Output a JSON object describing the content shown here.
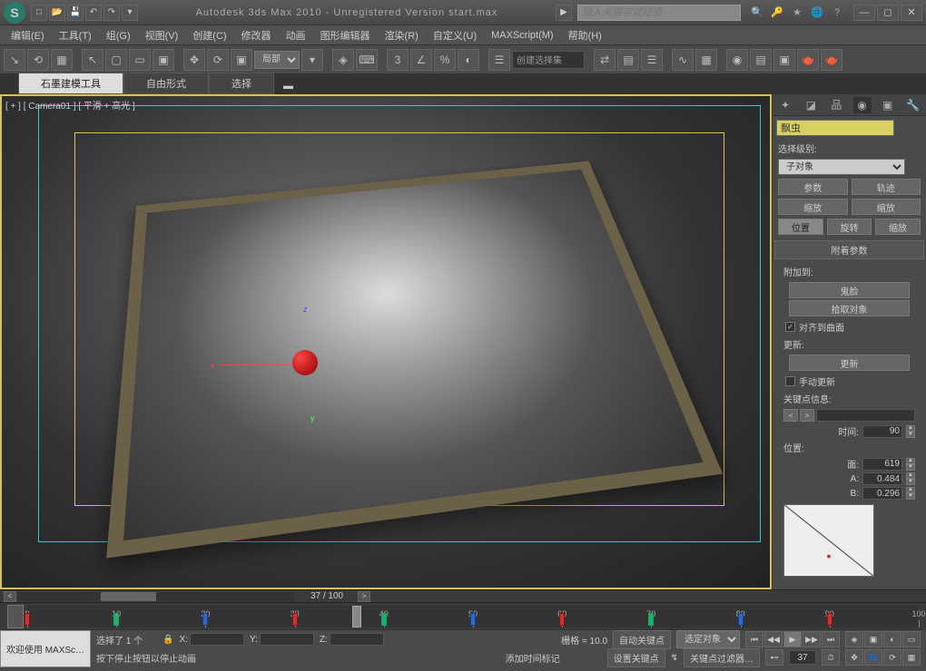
{
  "title": "Autodesk 3ds Max 2010  - Unregistered Version  start.max",
  "search_placeholder": "键入关键字或短语",
  "menus": [
    "编辑(E)",
    "工具(T)",
    "组(G)",
    "视图(V)",
    "创建(C)",
    "修改器",
    "动画",
    "图形编辑器",
    "渲染(R)",
    "自定义(U)",
    "MAXScript(M)",
    "帮助(H)"
  ],
  "coord_system": "局部",
  "named_sets": "创建选择集",
  "tabs": {
    "active": "石墨建模工具",
    "items": [
      "石墨建模工具",
      "自由形式",
      "选择"
    ]
  },
  "viewport_label": "[ + ] [ Camera01 ] [ 平滑 + 高光 ]",
  "frame_display": "37 / 100",
  "timeline": {
    "start": 0,
    "end": 100,
    "current": 37,
    "ticks": [
      0,
      10,
      20,
      30,
      40,
      50,
      60,
      70,
      80,
      90,
      100
    ],
    "keys": [
      0,
      10,
      20,
      30,
      40,
      50,
      60,
      70,
      80,
      90
    ]
  },
  "right_panel": {
    "obj_name": "飘虫",
    "selection_level_label": "选择级别:",
    "selection_level": "子对象",
    "tab_params": "参数",
    "tab_track": "轨迹",
    "scale1": "缩放",
    "scale2": "缩放",
    "pos": "位置",
    "rot": "旋转",
    "scale": "缩放",
    "rollout_attach": "附着参数",
    "attach_to": "附加到:",
    "ghost_face": "鬼脸",
    "pick_obj": "拾取对象",
    "align_surface": "对齐到曲面",
    "update_label": "更新:",
    "update_btn": "更新",
    "manual_update": "手动更新",
    "key_info": "关键点信息:",
    "time_label": "时间:",
    "time_val": "90",
    "pos_label": "位置:",
    "face_label": "面:",
    "face_val": "619",
    "a_label": "A:",
    "a_val": "0.484",
    "b_label": "B:",
    "b_val": "0.296"
  },
  "status": {
    "welcome": "欢迎使用 MAXSc…",
    "selected": "选择了 1 个",
    "x": "X:",
    "y": "Y:",
    "z": "Z:",
    "grid": "栅格 = 10.0",
    "auto_key": "自动关键点",
    "selected_obj": "选定对象",
    "hint": "按下停止按钮以停止动画",
    "add_marker": "添加时间标记",
    "set_key": "设置关键点",
    "key_filter": "关键点过滤器…",
    "frame": "37"
  },
  "gizmo": {
    "x": "x",
    "y": "y",
    "z": "z"
  }
}
